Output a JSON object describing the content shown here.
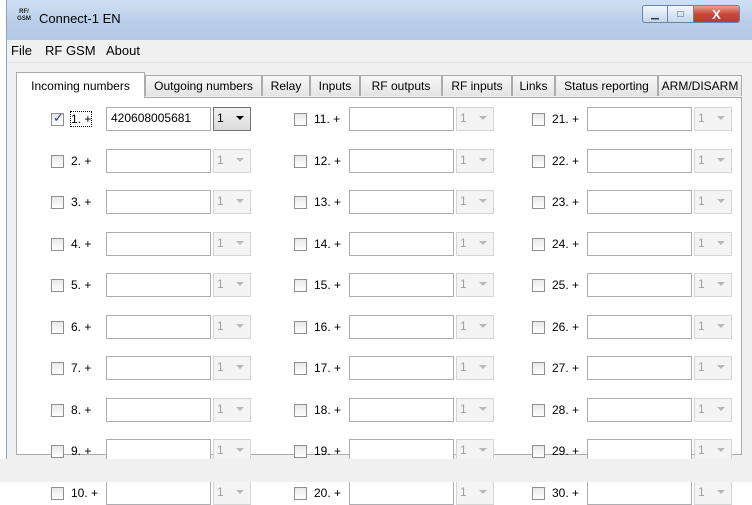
{
  "window": {
    "title": "Connect-1 EN",
    "icon_text": "RF/ GSM",
    "close_label": "X",
    "min_label": "▁",
    "max_label": "□"
  },
  "menu": [
    "File",
    "RF GSM",
    "About"
  ],
  "tabs": [
    "Incoming numbers",
    "Outgoing numbers",
    "Relay",
    "Inputs",
    "RF outputs",
    "RF inputs",
    "Links",
    "Status reporting",
    "ARM/DISARM"
  ],
  "active_tab": "Incoming numbers",
  "entries": [
    {
      "label": "1. +",
      "number": "420608005681",
      "option": "1",
      "checked": true,
      "enabled": true
    },
    {
      "label": "2. +",
      "number": "",
      "option": "1",
      "checked": false,
      "enabled": false
    },
    {
      "label": "3. +",
      "number": "",
      "option": "1",
      "checked": false,
      "enabled": false
    },
    {
      "label": "4. +",
      "number": "",
      "option": "1",
      "checked": false,
      "enabled": false
    },
    {
      "label": "5. +",
      "number": "",
      "option": "1",
      "checked": false,
      "enabled": false
    },
    {
      "label": "6. +",
      "number": "",
      "option": "1",
      "checked": false,
      "enabled": false
    },
    {
      "label": "7. +",
      "number": "",
      "option": "1",
      "checked": false,
      "enabled": false
    },
    {
      "label": "8. +",
      "number": "",
      "option": "1",
      "checked": false,
      "enabled": false
    },
    {
      "label": "9. +",
      "number": "",
      "option": "1",
      "checked": false,
      "enabled": false
    },
    {
      "label": "10. +",
      "number": "",
      "option": "1",
      "checked": false,
      "enabled": false
    },
    {
      "label": "11. +",
      "number": "",
      "option": "1",
      "checked": false,
      "enabled": false
    },
    {
      "label": "12. +",
      "number": "",
      "option": "1",
      "checked": false,
      "enabled": false
    },
    {
      "label": "13. +",
      "number": "",
      "option": "1",
      "checked": false,
      "enabled": false
    },
    {
      "label": "14. +",
      "number": "",
      "option": "1",
      "checked": false,
      "enabled": false
    },
    {
      "label": "15. +",
      "number": "",
      "option": "1",
      "checked": false,
      "enabled": false
    },
    {
      "label": "16. +",
      "number": "",
      "option": "1",
      "checked": false,
      "enabled": false
    },
    {
      "label": "17. +",
      "number": "",
      "option": "1",
      "checked": false,
      "enabled": false
    },
    {
      "label": "18. +",
      "number": "",
      "option": "1",
      "checked": false,
      "enabled": false
    },
    {
      "label": "19. +",
      "number": "",
      "option": "1",
      "checked": false,
      "enabled": false
    },
    {
      "label": "20. +",
      "number": "",
      "option": "1",
      "checked": false,
      "enabled": false
    },
    {
      "label": "21. +",
      "number": "",
      "option": "1",
      "checked": false,
      "enabled": false
    },
    {
      "label": "22. +",
      "number": "",
      "option": "1",
      "checked": false,
      "enabled": false
    },
    {
      "label": "23. +",
      "number": "",
      "option": "1",
      "checked": false,
      "enabled": false
    },
    {
      "label": "24. +",
      "number": "",
      "option": "1",
      "checked": false,
      "enabled": false
    },
    {
      "label": "25. +",
      "number": "",
      "option": "1",
      "checked": false,
      "enabled": false
    },
    {
      "label": "26. +",
      "number": "",
      "option": "1",
      "checked": false,
      "enabled": false
    },
    {
      "label": "27. +",
      "number": "",
      "option": "1",
      "checked": false,
      "enabled": false
    },
    {
      "label": "28. +",
      "number": "",
      "option": "1",
      "checked": false,
      "enabled": false
    },
    {
      "label": "29. +",
      "number": "",
      "option": "1",
      "checked": false,
      "enabled": false
    },
    {
      "label": "30. +",
      "number": "",
      "option": "1",
      "checked": false,
      "enabled": false
    }
  ]
}
